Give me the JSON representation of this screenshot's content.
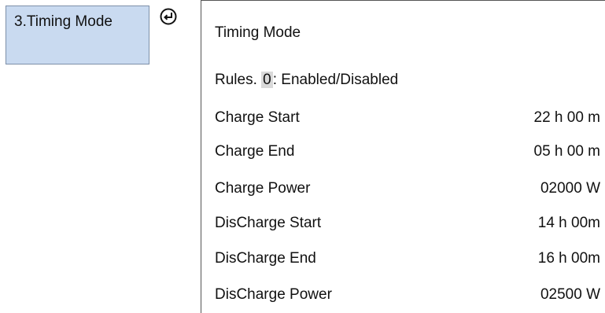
{
  "menu": {
    "label": "3.Timing Mode"
  },
  "icons": {
    "enter": "enter-arrow-icon"
  },
  "panel": {
    "title": "Timing Mode",
    "rules_prefix": "Rules. ",
    "rules_value": "0",
    "rules_suffix": ": Enabled/Disabled",
    "rows": [
      {
        "label": "Charge Start",
        "value": "22 h 00 m"
      },
      {
        "label": "Charge End",
        "value": "05 h 00 m"
      },
      {
        "label": "Charge Power",
        "value": "02000 W"
      },
      {
        "label": "DisCharge Start",
        "value": "14 h 00m"
      },
      {
        "label": "DisCharge End",
        "value": "16 h 00m"
      },
      {
        "label": "DisCharge Power",
        "value": "02500 W"
      }
    ]
  }
}
